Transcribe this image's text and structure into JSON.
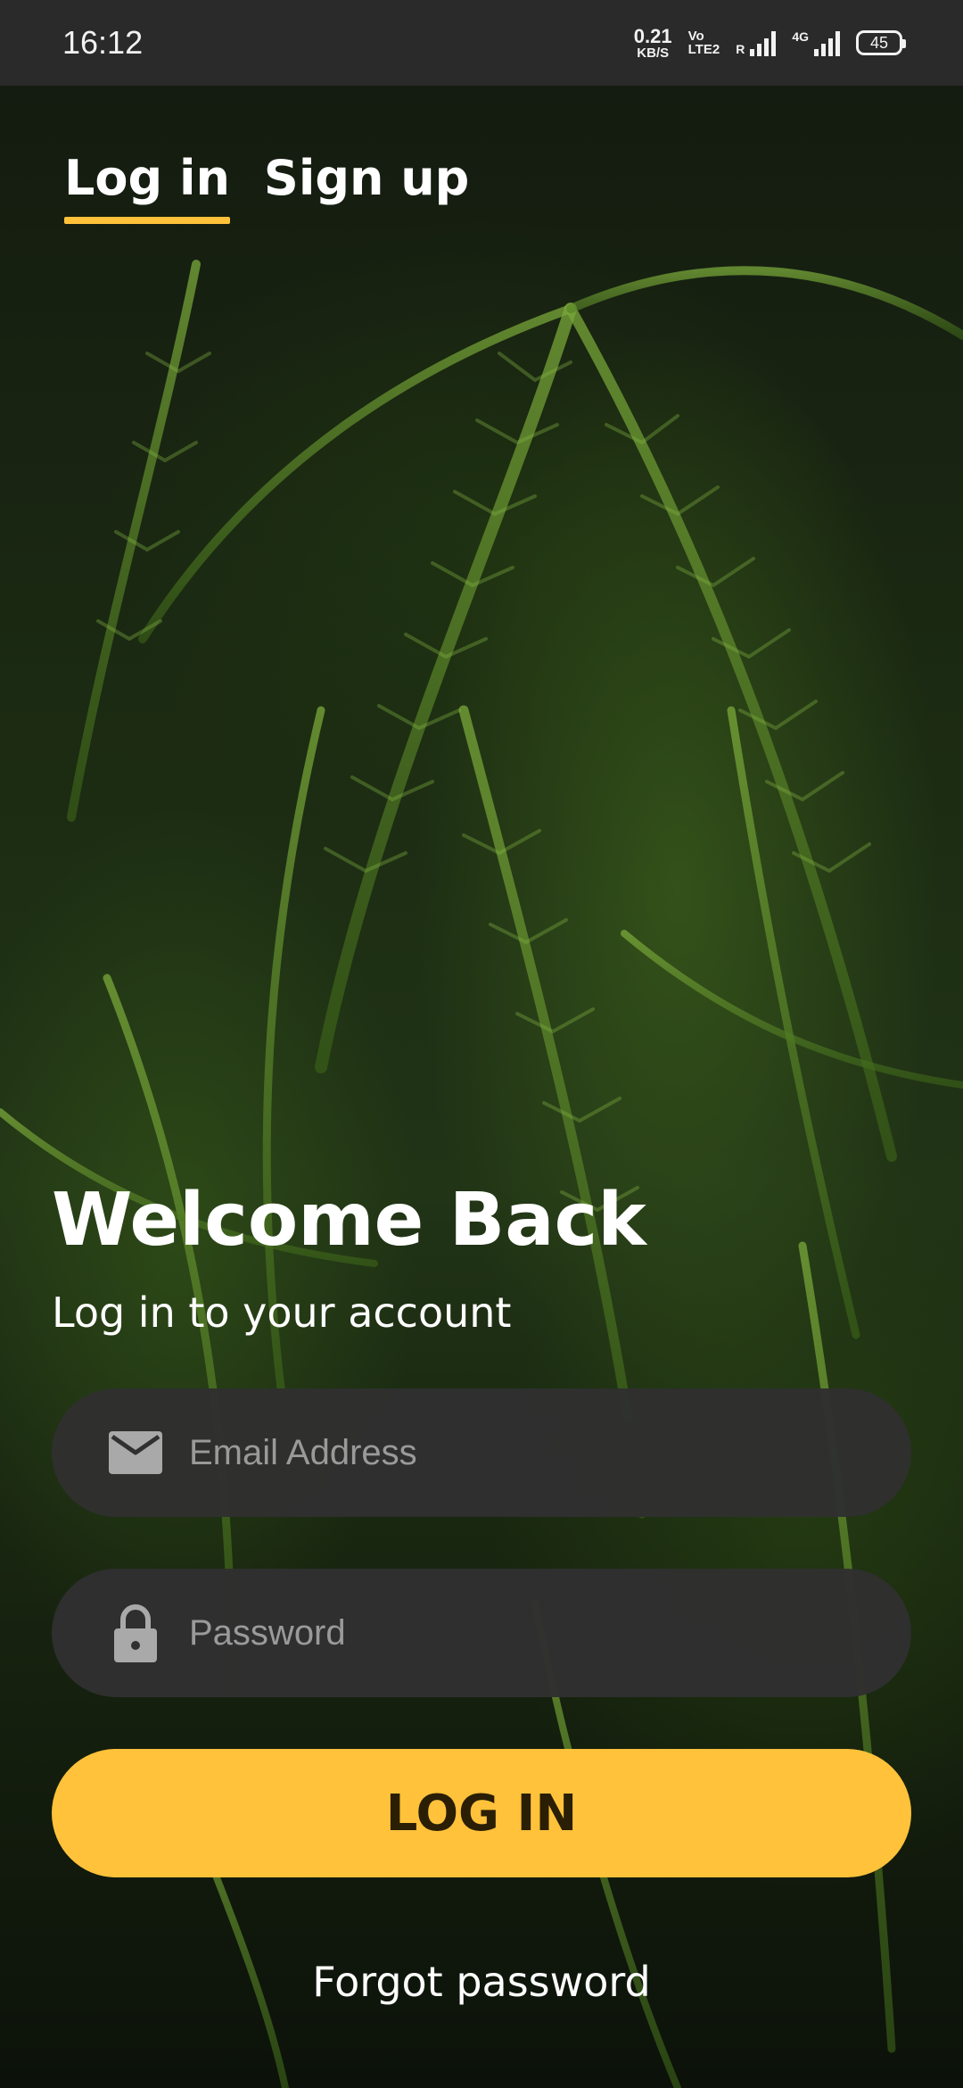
{
  "status_bar": {
    "time": "16:12",
    "net_speed_value": "0.21",
    "net_speed_unit": "KB/S",
    "volte_top": "Vo",
    "volte_bottom": "LTE2",
    "sim1_label": "R",
    "sim2_label": "4G",
    "battery": "45"
  },
  "tabs": [
    {
      "label": "Log in",
      "active": true
    },
    {
      "label": "Sign up",
      "active": false
    }
  ],
  "heading": {
    "title": "Welcome Back",
    "subtitle": "Log in to your account"
  },
  "form": {
    "email_placeholder": "Email Address",
    "password_placeholder": "Password",
    "login_button": "LOG IN",
    "forgot_password": "Forgot password"
  },
  "colors": {
    "accent": "#ffc23a",
    "field_bg": "#303030",
    "status_bar_bg": "#2a2a2a"
  },
  "icons": {
    "email": "envelope-icon",
    "password": "lock-icon"
  }
}
